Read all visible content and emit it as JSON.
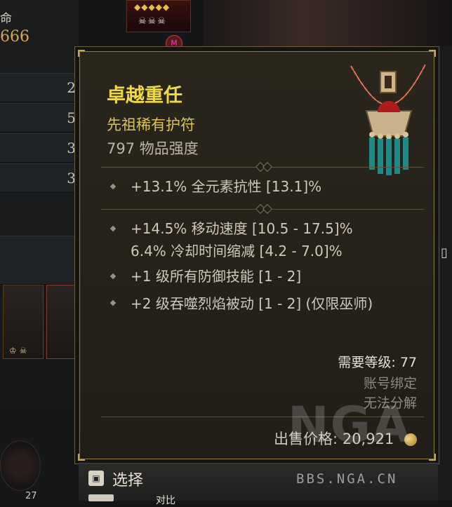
{
  "background": {
    "stat_label": "命",
    "stat_value": "666",
    "row_values": [
      "2",
      "5",
      "3",
      "3"
    ],
    "slot_counter": "27",
    "rank_badge": "M"
  },
  "tooltip": {
    "name": "卓越重任",
    "type": "先祖稀有护符",
    "item_power": "797 物品强度",
    "implicit_affixes": [
      "+13.1% 全元素抗性 [13.1]%"
    ],
    "affixes": [
      "+14.5% 移动速度 [10.5 - 17.5]%",
      "6.4% 冷却时间缩减 [4.2 - 7.0]%",
      "+1 级所有防御技能 [1 - 2]",
      "+2 级吞噬烈焰被动 [1 - 2] (仅限巫师)"
    ],
    "required_level": "需要等级: 77",
    "account_bound": "账号绑定",
    "cannot_salvage": "无法分解",
    "sell_price_label": "出售价格:",
    "sell_price_value": "20,921"
  },
  "hint_bar": {
    "select_label": "选择",
    "compare_label": "对比"
  },
  "watermark": {
    "logo": "NGA",
    "site": "BBS.NGA.CN"
  },
  "colors": {
    "legendary_name": "#efd848",
    "rare_type": "#d9c25a",
    "text": "#cfc9bb",
    "muted": "#8e8a80"
  }
}
